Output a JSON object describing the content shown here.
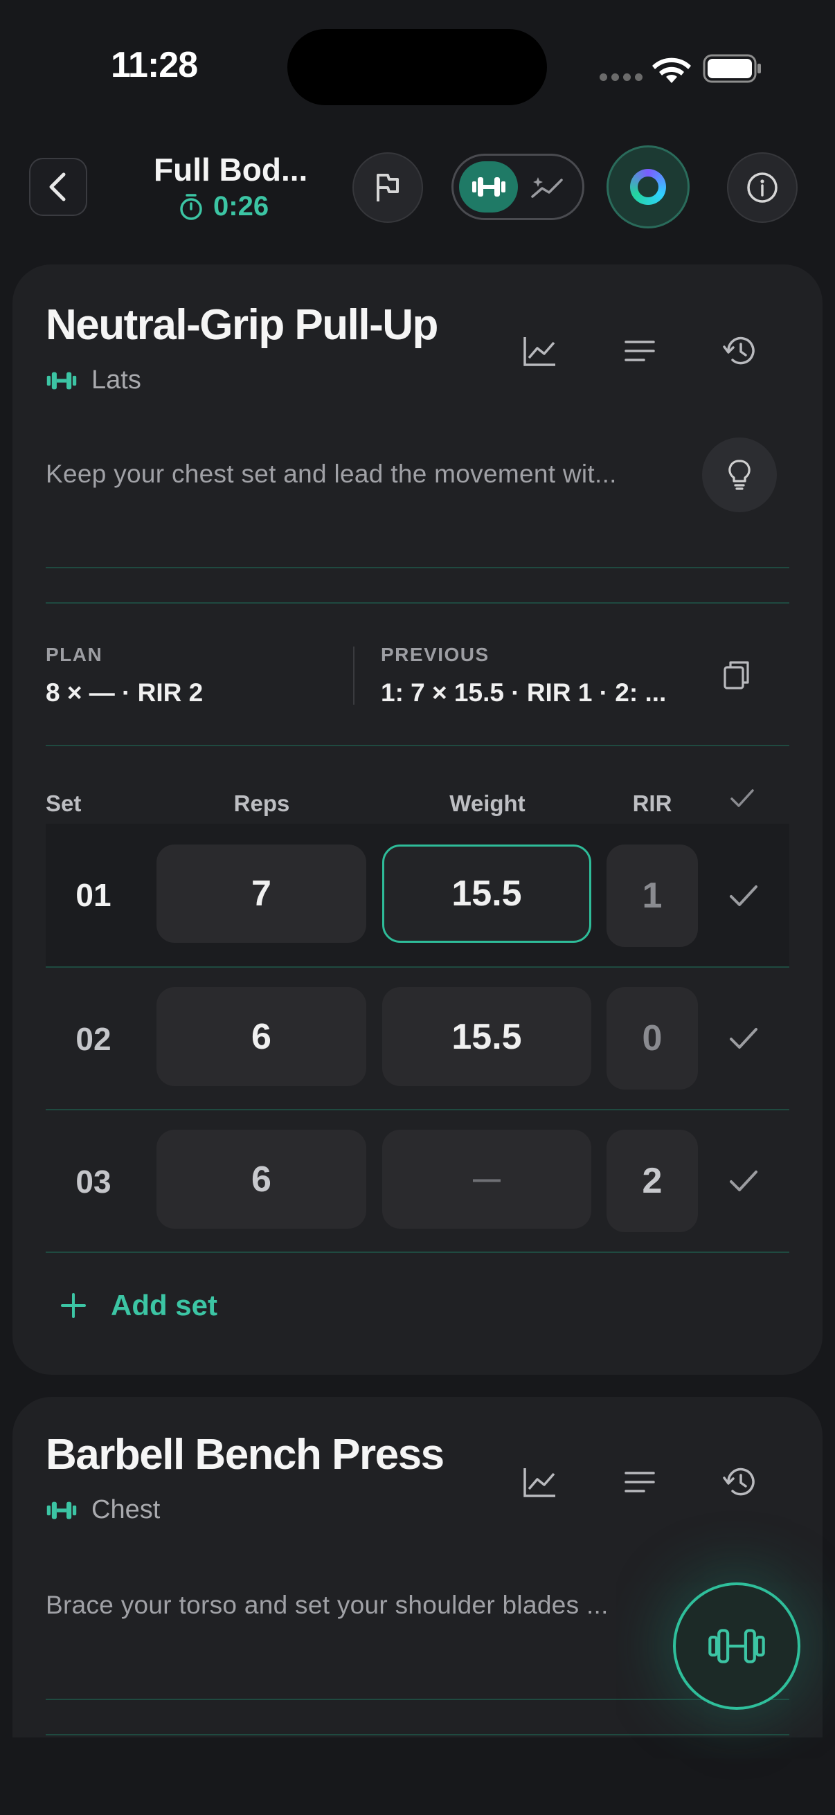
{
  "status_bar": {
    "time": "11:28"
  },
  "header": {
    "workout_title": "Full Bod...",
    "timer": "0:26"
  },
  "exercises": [
    {
      "name": "Neutral-Grip Pull-Up",
      "muscle": "Lats",
      "description": "Keep your chest set and lead the movement wit...",
      "plan_label": "PLAN",
      "plan_value": "8 × —  ·  RIR 2",
      "previous_label": "PREVIOUS",
      "previous_value": "1: 7 × 15.5  ·  RIR 1   ·   2: ...",
      "columns": {
        "set": "Set",
        "reps": "Reps",
        "weight": "Weight",
        "rir": "RIR"
      },
      "sets": [
        {
          "num": "01",
          "reps": "7",
          "weight": "15.5",
          "rir": "1"
        },
        {
          "num": "02",
          "reps": "6",
          "weight": "15.5",
          "rir": "0"
        },
        {
          "num": "03",
          "reps": "6",
          "weight": "—",
          "rir": "2"
        }
      ],
      "add_set_label": "Add set"
    },
    {
      "name": "Barbell Bench Press",
      "muscle": "Chest",
      "description": "Brace your torso and set your shoulder blades ..."
    }
  ],
  "colors": {
    "accent": "#3cc5a4",
    "background": "#17181b",
    "card": "#202124"
  },
  "icons": [
    "chevron-left-icon",
    "stopwatch-icon",
    "flag-icon",
    "dumbbell-icon",
    "sparkle-chart-icon",
    "ai-ring-icon",
    "info-icon",
    "chart-icon",
    "notes-icon",
    "history-icon",
    "lightbulb-icon",
    "copy-icon",
    "check-icon",
    "plus-icon"
  ]
}
